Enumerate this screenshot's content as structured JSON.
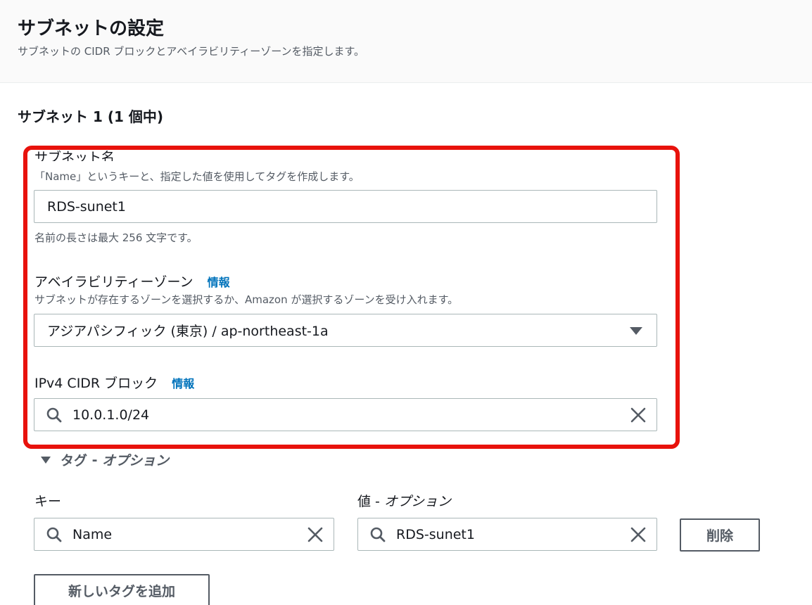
{
  "header": {
    "title": "サブネットの設定",
    "description": "サブネットの CIDR ブロックとアベイラビリティーゾーンを指定します。"
  },
  "subnet": {
    "heading": "サブネット 1 (1 個中)",
    "name": {
      "label": "サブネット名",
      "description": "「Name」というキーと、指定した値を使用してタグを作成します。",
      "value": "RDS-sunet1",
      "constraint": "名前の長さは最大 256 文字です。"
    },
    "availability_zone": {
      "label": "アベイラビリティーゾーン",
      "info": "情報",
      "description": "サブネットが存在するゾーンを選択するか、Amazon が選択するゾーンを受け入れます。",
      "selected": "アジアパシフィック (東京) / ap-northeast-1a"
    },
    "cidr": {
      "label": "IPv4 CIDR ブロック",
      "info": "情報",
      "value": "10.0.1.0/24"
    }
  },
  "tags": {
    "toggle_label": "タグ",
    "toggle_separator": " - ",
    "toggle_optional": "オプション",
    "key_label": "キー",
    "value_label": "値",
    "value_separator": " - ",
    "value_optional": "オプション",
    "key_value": "Name",
    "value_value": "RDS-sunet1",
    "remove_button": "削除",
    "add_button": "新しいタグを追加"
  },
  "colors": {
    "highlight": "#e8120c",
    "link": "#0073bb"
  }
}
